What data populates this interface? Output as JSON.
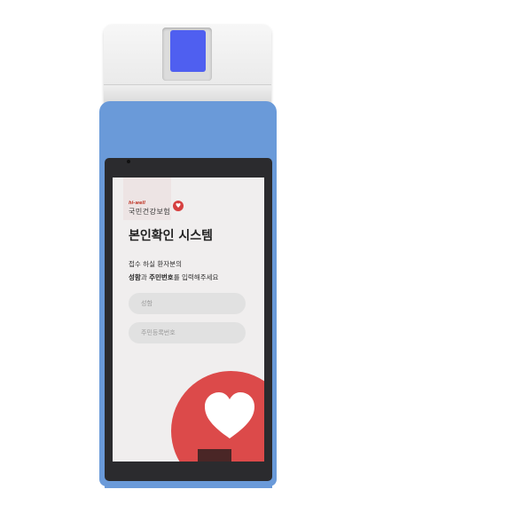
{
  "screen": {
    "logo": {
      "script": "hi-well",
      "name": "국민건강보험"
    },
    "title": "본인확인 시스템",
    "instruction": {
      "line1": "접수 하실 환자분의",
      "line2_bold1": "성함",
      "line2_part2": "과 ",
      "line2_bold2": "주민번호",
      "line2_part3": "를 입력해주세요"
    },
    "fields": {
      "name_placeholder": "성함",
      "rrn_placeholder": "주민등록번호"
    }
  },
  "colors": {
    "device_blue": "#6a9ad9",
    "scanner_glass": "#4f5ff0",
    "brand_red": "#dc4a4a"
  }
}
